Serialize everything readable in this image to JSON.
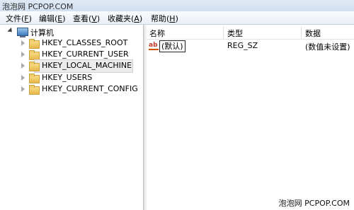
{
  "watermark": {
    "top": "泡泡网 PCPOP.COM",
    "bottom": "泡泡网 PCPOP.COM"
  },
  "menu": {
    "items": [
      {
        "label": "文件(",
        "hotkey": "F",
        "end": ")"
      },
      {
        "label": "编辑(",
        "hotkey": "E",
        "end": ")"
      },
      {
        "label": "查看(",
        "hotkey": "V",
        "end": ")"
      },
      {
        "label": "收藏夹(",
        "hotkey": "A",
        "end": ")"
      },
      {
        "label": "帮助(",
        "hotkey": "H",
        "end": ")"
      }
    ]
  },
  "tree": {
    "root": {
      "label": "计算机",
      "icon": "computer-icon"
    },
    "children": [
      {
        "label": "HKEY_CLASSES_ROOT"
      },
      {
        "label": "HKEY_CURRENT_USER"
      },
      {
        "label": "HKEY_LOCAL_MACHINE",
        "selected": true
      },
      {
        "label": "HKEY_USERS"
      },
      {
        "label": "HKEY_CURRENT_CONFIG"
      }
    ]
  },
  "list": {
    "columns": [
      "名称",
      "类型",
      "数据"
    ],
    "rows": [
      {
        "name": "(默认)",
        "type": "REG_SZ",
        "data": "(数值未设置)",
        "icon": "string-value-icon"
      }
    ]
  }
}
